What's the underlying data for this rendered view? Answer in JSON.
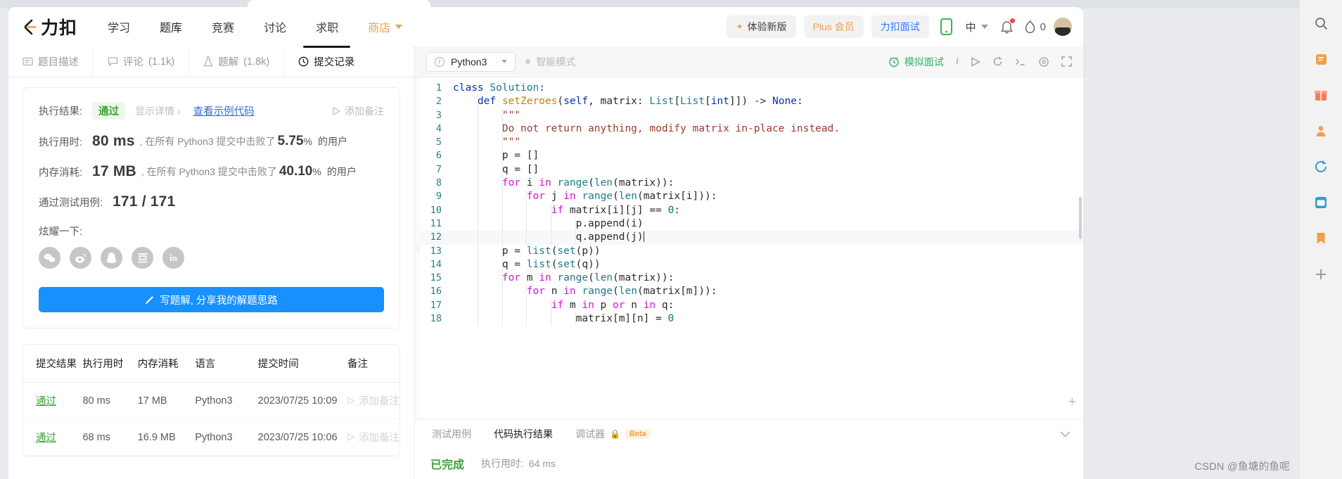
{
  "header": {
    "logo_text": "力扣",
    "nav": [
      {
        "label": "学习",
        "active": false
      },
      {
        "label": "题库",
        "active": true
      },
      {
        "label": "竞赛",
        "active": false
      },
      {
        "label": "讨论",
        "active": false
      },
      {
        "label": "求职",
        "active": false
      },
      {
        "label": "商店",
        "active": false
      }
    ],
    "try_new_label": "体验新版",
    "plus_label": "Plus 会员",
    "interview_label": "力扣面试",
    "lang_label": "中",
    "streak_count": "0",
    "accent_orange": "#f0a04b",
    "accent_blue": "#2f7fff",
    "notify_dot_color": "#ff4343"
  },
  "left": {
    "tabs": [
      {
        "label": "题目描述",
        "count": "",
        "active": false
      },
      {
        "label": "评论",
        "count": "(1.1k)",
        "active": false
      },
      {
        "label": "题解",
        "count": "(1.8k)",
        "active": false
      },
      {
        "label": "提交记录",
        "count": "",
        "active": true
      }
    ],
    "result": {
      "result_label": "执行结果:",
      "status": "通过",
      "show_detail": "显示详情 ›",
      "view_sample": "查看示例代码",
      "add_note": "添加备注",
      "runtime_label": "执行用时:",
      "runtime_value": "80 ms",
      "runtime_mid": ", 在所有 Python3 提交中击败了",
      "runtime_pct": "5.75",
      "memory_label": "内存消耗:",
      "memory_value": "17 MB",
      "memory_mid": ", 在所有 Python3 提交中击败了",
      "memory_pct": "40.10",
      "suffix_users": "的用户",
      "cases_label": "通过测试用例:",
      "cases_value": "171 / 171",
      "share_label": "炫耀一下:",
      "share_icons": [
        "wechat-icon",
        "weibo-icon",
        "qq-icon",
        "douban-icon",
        "linkedin-icon"
      ],
      "solve_btn": "写题解, 分享我的解题思路"
    },
    "table": {
      "columns": [
        "提交结果",
        "执行用时",
        "内存消耗",
        "语言",
        "提交时间",
        "备注"
      ],
      "rows": [
        {
          "result": "通过",
          "runtime": "80 ms",
          "memory": "17 MB",
          "lang": "Python3",
          "time": "2023/07/25 10:09",
          "note": "添加备注"
        },
        {
          "result": "通过",
          "runtime": "68 ms",
          "memory": "16.9 MB",
          "lang": "Python3",
          "time": "2023/07/25 10:06",
          "note": "添加备注"
        }
      ]
    }
  },
  "editor": {
    "language": "Python3",
    "smart_mode": "智能模式",
    "mock_interview": "模拟面试",
    "toolbar_icons": [
      "info-icon",
      "run-icon",
      "reset-icon",
      "console-icon",
      "settings-icon",
      "fullscreen-icon"
    ],
    "lines": [
      {
        "n": "1",
        "indent": 0,
        "tokens": [
          {
            "t": "class ",
            "c": "kw"
          },
          {
            "t": "Solution",
            "c": "cls"
          },
          {
            "t": ":",
            "c": ""
          }
        ]
      },
      {
        "n": "2",
        "indent": 1,
        "tokens": [
          {
            "t": "    ",
            "c": ""
          },
          {
            "t": "def ",
            "c": "kw"
          },
          {
            "t": "setZeroes",
            "c": "fn"
          },
          {
            "t": "(",
            "c": ""
          },
          {
            "t": "self",
            "c": "param"
          },
          {
            "t": ", matrix: ",
            "c": ""
          },
          {
            "t": "List",
            "c": "cls"
          },
          {
            "t": "[",
            "c": ""
          },
          {
            "t": "List",
            "c": "cls"
          },
          {
            "t": "[",
            "c": ""
          },
          {
            "t": "int",
            "c": "kw"
          },
          {
            "t": "]]) -> ",
            "c": ""
          },
          {
            "t": "None",
            "c": "kw"
          },
          {
            "t": ":",
            "c": ""
          }
        ]
      },
      {
        "n": "3",
        "indent": 2,
        "tokens": [
          {
            "t": "        ",
            "c": ""
          },
          {
            "t": "\"\"\"",
            "c": "str"
          }
        ]
      },
      {
        "n": "4",
        "indent": 2,
        "tokens": [
          {
            "t": "        ",
            "c": ""
          },
          {
            "t": "Do not return anything, modify matrix in-place instead.",
            "c": "str"
          }
        ]
      },
      {
        "n": "5",
        "indent": 2,
        "tokens": [
          {
            "t": "        ",
            "c": ""
          },
          {
            "t": "\"\"\"",
            "c": "str"
          }
        ]
      },
      {
        "n": "6",
        "indent": 2,
        "tokens": [
          {
            "t": "        p = []",
            "c": ""
          }
        ]
      },
      {
        "n": "7",
        "indent": 2,
        "tokens": [
          {
            "t": "        q = []",
            "c": ""
          }
        ]
      },
      {
        "n": "8",
        "indent": 2,
        "tokens": [
          {
            "t": "        ",
            "c": ""
          },
          {
            "t": "for",
            "c": "kw2"
          },
          {
            "t": " i ",
            "c": ""
          },
          {
            "t": "in",
            "c": "kw2"
          },
          {
            "t": " ",
            "c": ""
          },
          {
            "t": "range",
            "c": "bi"
          },
          {
            "t": "(",
            "c": ""
          },
          {
            "t": "len",
            "c": "bi"
          },
          {
            "t": "(matrix)):",
            "c": ""
          }
        ]
      },
      {
        "n": "9",
        "indent": 3,
        "tokens": [
          {
            "t": "            ",
            "c": ""
          },
          {
            "t": "for",
            "c": "kw2"
          },
          {
            "t": " j ",
            "c": ""
          },
          {
            "t": "in",
            "c": "kw2"
          },
          {
            "t": " ",
            "c": ""
          },
          {
            "t": "range",
            "c": "bi"
          },
          {
            "t": "(",
            "c": ""
          },
          {
            "t": "len",
            "c": "bi"
          },
          {
            "t": "(matrix[i])):",
            "c": ""
          }
        ]
      },
      {
        "n": "10",
        "indent": 4,
        "tokens": [
          {
            "t": "                ",
            "c": ""
          },
          {
            "t": "if",
            "c": "kw2"
          },
          {
            "t": " matrix[i][j] == ",
            "c": ""
          },
          {
            "t": "0",
            "c": "num"
          },
          {
            "t": ":",
            "c": ""
          }
        ]
      },
      {
        "n": "11",
        "indent": 5,
        "tokens": [
          {
            "t": "                    p.append(i)",
            "c": ""
          }
        ]
      },
      {
        "n": "12",
        "indent": 5,
        "tokens": [
          {
            "t": "                    q.append(j)",
            "c": ""
          }
        ],
        "cursor": true
      },
      {
        "n": "13",
        "indent": 2,
        "tokens": [
          {
            "t": "        p = ",
            "c": ""
          },
          {
            "t": "list",
            "c": "bi"
          },
          {
            "t": "(",
            "c": ""
          },
          {
            "t": "set",
            "c": "bi"
          },
          {
            "t": "(p))",
            "c": ""
          }
        ]
      },
      {
        "n": "14",
        "indent": 2,
        "tokens": [
          {
            "t": "        q = ",
            "c": ""
          },
          {
            "t": "list",
            "c": "bi"
          },
          {
            "t": "(",
            "c": ""
          },
          {
            "t": "set",
            "c": "bi"
          },
          {
            "t": "(q))",
            "c": ""
          }
        ]
      },
      {
        "n": "15",
        "indent": 2,
        "tokens": [
          {
            "t": "        ",
            "c": ""
          },
          {
            "t": "for",
            "c": "kw2"
          },
          {
            "t": " m ",
            "c": ""
          },
          {
            "t": "in",
            "c": "kw2"
          },
          {
            "t": " ",
            "c": ""
          },
          {
            "t": "range",
            "c": "bi"
          },
          {
            "t": "(",
            "c": ""
          },
          {
            "t": "len",
            "c": "bi"
          },
          {
            "t": "(matrix)):",
            "c": ""
          }
        ]
      },
      {
        "n": "16",
        "indent": 3,
        "tokens": [
          {
            "t": "            ",
            "c": ""
          },
          {
            "t": "for",
            "c": "kw2"
          },
          {
            "t": " n ",
            "c": ""
          },
          {
            "t": "in",
            "c": "kw2"
          },
          {
            "t": " ",
            "c": ""
          },
          {
            "t": "range",
            "c": "bi"
          },
          {
            "t": "(",
            "c": ""
          },
          {
            "t": "len",
            "c": "bi"
          },
          {
            "t": "(matrix[m])):",
            "c": ""
          }
        ]
      },
      {
        "n": "17",
        "indent": 4,
        "tokens": [
          {
            "t": "                ",
            "c": ""
          },
          {
            "t": "if",
            "c": "kw2"
          },
          {
            "t": " m ",
            "c": ""
          },
          {
            "t": "in",
            "c": "kw2"
          },
          {
            "t": " p ",
            "c": ""
          },
          {
            "t": "or",
            "c": "kw2"
          },
          {
            "t": " n ",
            "c": ""
          },
          {
            "t": "in",
            "c": "kw2"
          },
          {
            "t": " q:",
            "c": ""
          }
        ]
      },
      {
        "n": "18",
        "indent": 5,
        "tokens": [
          {
            "t": "                    matrix[m][n] = ",
            "c": ""
          },
          {
            "t": "0",
            "c": "num"
          }
        ]
      }
    ],
    "bottom_tabs": [
      {
        "label": "测试用例",
        "active": false,
        "beta": ""
      },
      {
        "label": "代码执行结果",
        "active": true,
        "beta": ""
      },
      {
        "label": "调试器",
        "active": false,
        "beta": "Beta"
      }
    ],
    "bottom_result": {
      "status": "已完成",
      "exec_label": "执行用时:",
      "exec_value": "64 ms"
    }
  },
  "rail": {
    "icons": [
      "search-icon",
      "note-icon",
      "gift-icon",
      "person-icon",
      "refresh-icon",
      "browser-icon",
      "bookmark-icon",
      "plus-icon"
    ]
  },
  "watermark": "CSDN @鱼塘的鱼呢"
}
